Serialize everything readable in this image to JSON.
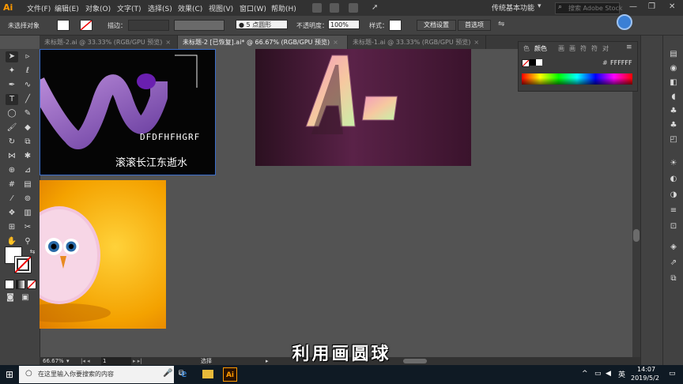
{
  "menubar": {
    "logo": "Ai",
    "items": [
      "文件(F)",
      "编辑(E)",
      "对象(O)",
      "文字(T)",
      "选择(S)",
      "效果(C)",
      "视图(V)",
      "窗口(W)",
      "帮助(H)"
    ],
    "workspace": "传统基本功能",
    "stock_placeholder": "搜索 Adobe Stock"
  },
  "controlbar": {
    "selection_status": "未选择对象",
    "stroke_label": "描边：",
    "brush": "5 点圆形",
    "opacity_label": "不透明度：",
    "opacity_value": "100%",
    "style_label": "样式：",
    "doc_settings": "文档设置",
    "preferences": "首选项"
  },
  "tabs": [
    {
      "label": "未标题-2.ai @ 33.33% (RGB/GPU 预览)",
      "active": false
    },
    {
      "label": "未标题-2 [已恢复].ai* @ 66.67% (RGB/GPU 预览)",
      "active": true
    },
    {
      "label": "未标题-1.ai @ 33.33% (RGB/GPU 预览)",
      "active": false
    }
  ],
  "color_panel": {
    "tabs": [
      "色",
      "颜色",
      "画",
      "画",
      "符",
      "符",
      "对"
    ],
    "hex": "FFFFFF",
    "hash": "#"
  },
  "artboards": {
    "black_text_en": "DFDFHFHGRF",
    "black_text_cn": "滚滚长江东逝水",
    "logo_text": "Ai"
  },
  "statusbar": {
    "zoom": "66.67%",
    "page": "1",
    "tool": "选择"
  },
  "subtitle": "利用画圆球",
  "taskbar": {
    "search_placeholder": "在这里输入你要搜索的内容",
    "ime": "英",
    "time": "14:07",
    "date": "2019/5/2"
  },
  "colors": {
    "accent": "#ff9a00",
    "purple_bg": "#3a1630",
    "orange_bg": "#f4a200"
  }
}
